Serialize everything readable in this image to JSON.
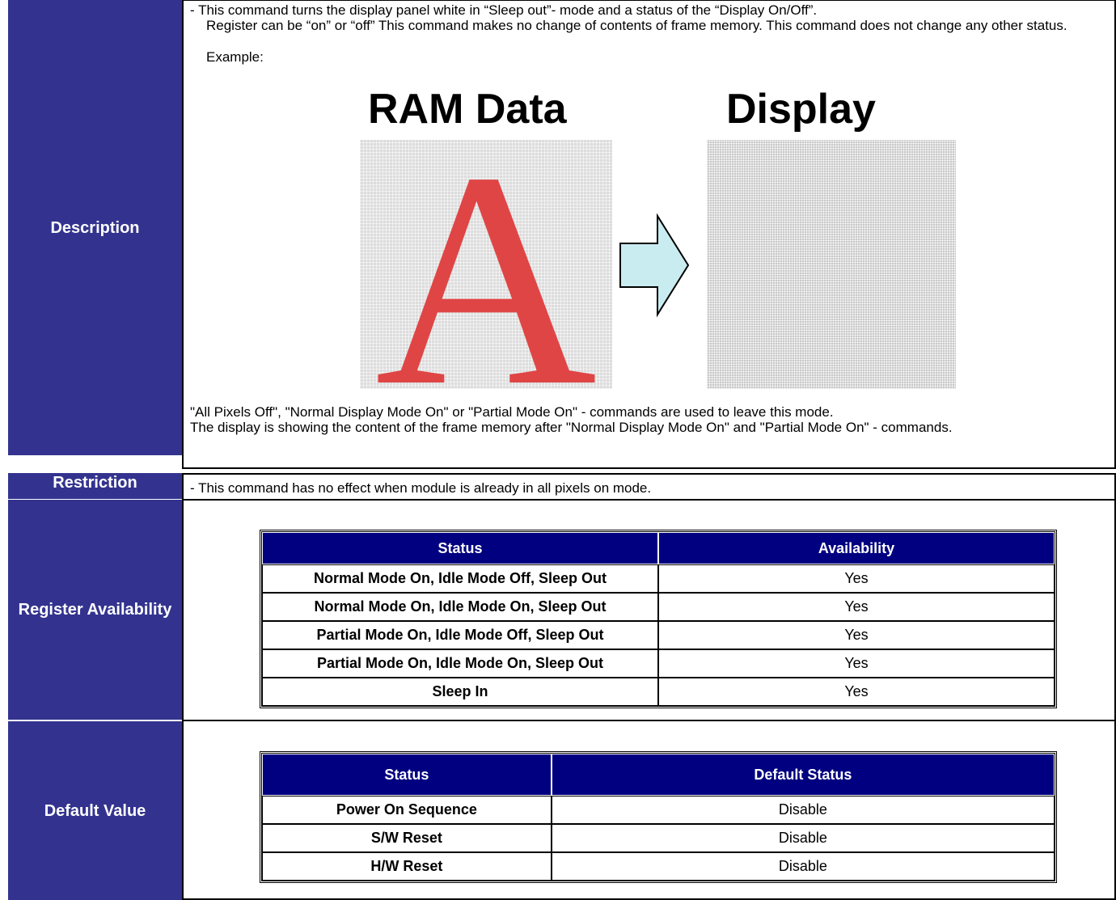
{
  "labels": {
    "description": "Description",
    "restriction": "Restriction",
    "register_availability": "Register Availability",
    "default_value": "Default Value"
  },
  "description": {
    "line1": "- This command turns the display panel white in “Sleep out”- mode and a status of the “Display On/Off”.",
    "line2": "Register can be “on” or “off” This command makes no change of contents of frame memory. This command does not change any other status.",
    "example": "Example:",
    "figure_ram_title": "RAM Data",
    "figure_display_title": "Display",
    "figure_letter": "A",
    "line3": "\"All Pixels Off\", \"Normal Display Mode On\" or \"Partial Mode On\" - commands are used to leave this mode.",
    "line4": "The display is showing the content of the frame memory after \"Normal Display Mode On\" and \"Partial Mode On\" - commands."
  },
  "restriction": {
    "text": "- This command has no effect when module is already in all pixels on mode."
  },
  "register_table": {
    "headers": [
      "Status",
      "Availability"
    ],
    "rows": [
      [
        "Normal Mode On, Idle Mode Off, Sleep Out",
        "Yes"
      ],
      [
        "Normal Mode On, Idle Mode On, Sleep Out",
        "Yes"
      ],
      [
        "Partial Mode On, Idle Mode Off, Sleep Out",
        "Yes"
      ],
      [
        "Partial Mode On, Idle Mode On, Sleep Out",
        "Yes"
      ],
      [
        "Sleep In",
        "Yes"
      ]
    ]
  },
  "default_table": {
    "headers": [
      "Status",
      "Default Status"
    ],
    "rows": [
      [
        "Power On Sequence",
        "Disable"
      ],
      [
        "S/W Reset",
        "Disable"
      ],
      [
        "H/W Reset",
        "Disable"
      ]
    ]
  },
  "colors": {
    "label_bg": "#33338f",
    "table_header_bg": "#000080",
    "letter_red": "#e04545",
    "arrow_fill": "#c9ecf0"
  }
}
